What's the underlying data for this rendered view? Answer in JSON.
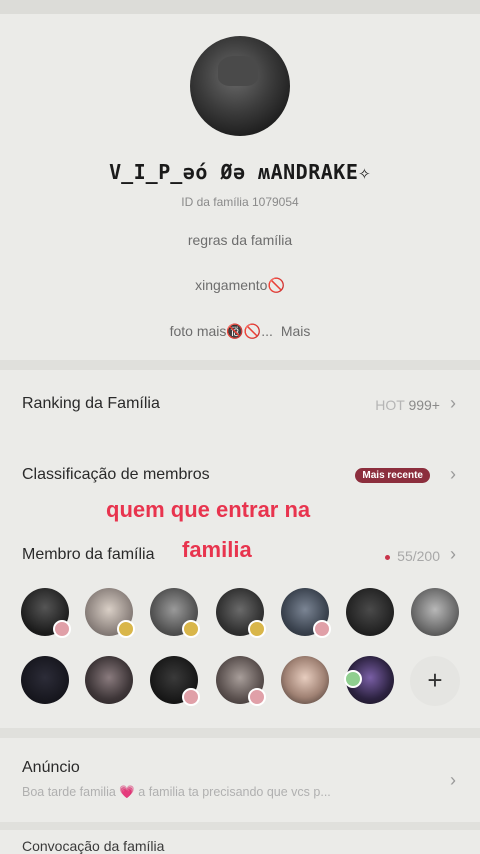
{
  "family": {
    "name": "V̲I̲P̲əó Øə ʍANDRAKE✧",
    "id_text": "ID da família 1079054",
    "rules": [
      "regras da família",
      "xingamento🚫",
      "foto mais🔞🚫..."
    ],
    "more_label": "Mais"
  },
  "ranking": {
    "label": "Ranking da Família",
    "hot_label": "HOT",
    "hot_value": "999+"
  },
  "classification": {
    "label": "Classificação de membros",
    "badge": "Mais recente"
  },
  "members": {
    "label": "Membro da família",
    "count": "55/200"
  },
  "overlay": {
    "line1": "quem que entrar na",
    "line2": "familia"
  },
  "colors": {
    "accent": "#e8344e",
    "badge": "#8c2e3d",
    "level_gold": "#d9b64a",
    "level_pink": "#e0a0a8"
  },
  "announcement": {
    "label": "Anúncio",
    "text": "Boa tarde  familia 💗  a familia ta precisando que vcs p..."
  },
  "bottom": {
    "label": "Convocação da família"
  },
  "icons": {
    "chevron": "chevron-right-icon",
    "add": "plus-icon"
  }
}
